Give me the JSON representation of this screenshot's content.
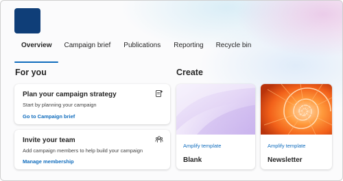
{
  "brand": {
    "logo_color": "#0f3e78",
    "accent": "#0f6cbd"
  },
  "tabs": [
    {
      "label": "Overview",
      "active": true
    },
    {
      "label": "Campaign brief",
      "active": false
    },
    {
      "label": "Publications",
      "active": false
    },
    {
      "label": "Reporting",
      "active": false
    },
    {
      "label": "Recycle bin",
      "active": false
    }
  ],
  "for_you": {
    "heading": "For you",
    "cards": [
      {
        "title": "Plan your campaign strategy",
        "description": "Start by planning your campaign",
        "link": "Go to Campaign brief",
        "icon": "document-plan-icon"
      },
      {
        "title": "Invite your team",
        "description": "Add campaign members to help build your campaign",
        "link": "Manage membership",
        "icon": "people-team-icon"
      }
    ]
  },
  "create": {
    "heading": "Create",
    "tiles": [
      {
        "tag": "Amplify template",
        "name": "Blank"
      },
      {
        "tag": "Amplify template",
        "name": "Newsletter"
      }
    ]
  }
}
